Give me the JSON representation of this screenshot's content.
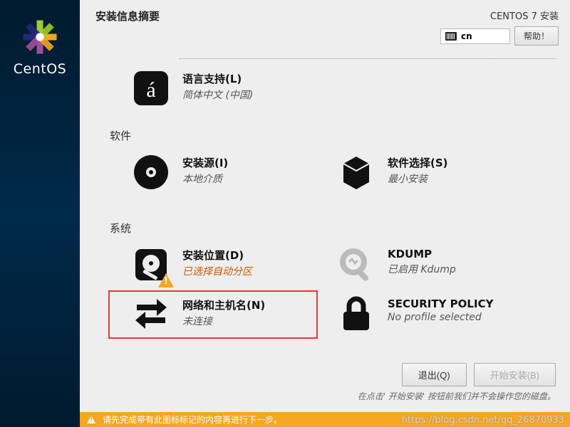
{
  "brand": "CentOS",
  "header": {
    "title": "安装信息摘要",
    "installer": "CENTOS 7 安装",
    "keyboard": "cn",
    "help": "帮助！"
  },
  "categories": {
    "software": "软件",
    "system": "系统"
  },
  "spokes": {
    "lang": {
      "title": "语言支持(L)",
      "sub": "简体中文 (中国)"
    },
    "source": {
      "title": "安装源(I)",
      "sub": "本地介质"
    },
    "swsel": {
      "title": "软件选择(S)",
      "sub": "最小安装"
    },
    "dest": {
      "title": "安装位置(D)",
      "sub": "已选择自动分区"
    },
    "kdump": {
      "title": "KDUMP",
      "sub": "已启用 Kdump"
    },
    "network": {
      "title": "网络和主机名(N)",
      "sub": "未连接"
    },
    "security": {
      "title": "SECURITY POLICY",
      "sub": "No profile selected"
    }
  },
  "buttons": {
    "quit": "退出(Q)",
    "begin": "开始安装(B)"
  },
  "notes": {
    "footer": "在点击' 开始安装' 按钮前我们并不会操作您的磁盘。",
    "warnbar": "请先完成带有此图标标记的内容再进行下一步。"
  },
  "watermark": "https://blog.csdn.net/qq_26870933"
}
